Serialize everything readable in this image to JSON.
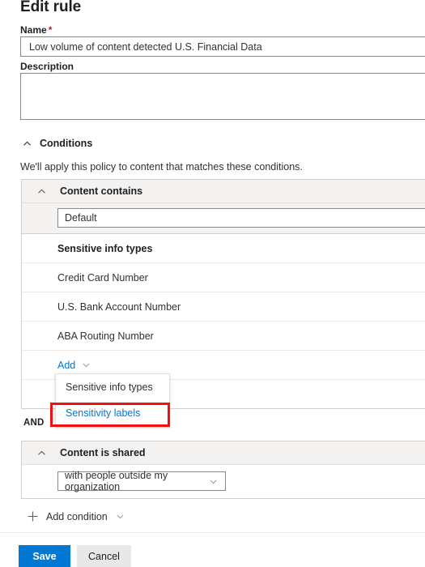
{
  "page": {
    "title": "Edit rule"
  },
  "name_field": {
    "label": "Name",
    "required_marker": "*",
    "value": "Low volume of content detected U.S. Financial Data",
    "placeholder": "Name"
  },
  "description_field": {
    "label": "Description",
    "value": "",
    "placeholder": ""
  },
  "conditions": {
    "header_label": "Conditions",
    "collapse_icon": "chevron-up-icon",
    "description": "We'll apply this policy to content that matches these conditions.",
    "and_label": "AND",
    "content_contains": {
      "header_label": "Content contains",
      "collapse_icon": "chevron-up-icon",
      "group_select_value": "Default",
      "list_header": "Sensitive info types",
      "items": [
        "Credit Card Number",
        "U.S. Bank Account Number",
        "ABA Routing Number"
      ],
      "add_label": "Add",
      "add_chevron_icon": "chevron-down-icon",
      "add_menu": {
        "options": [
          "Sensitive info types",
          "Sensitivity labels"
        ],
        "highlighted_option": "Sensitivity labels"
      }
    },
    "content_is_shared": {
      "header_label": "Content is shared",
      "collapse_icon": "chevron-up-icon",
      "select_value": "with people outside my organization",
      "select_chevron_icon": "chevron-down-icon"
    }
  },
  "add_condition": {
    "label": "Add condition",
    "plus_icon": "plus-icon",
    "chevron_icon": "chevron-down-icon"
  },
  "footer": {
    "save_label": "Save",
    "cancel_label": "Cancel"
  },
  "colors": {
    "accent": "#0078d4",
    "link": "#0078d4",
    "required": "#a4262c",
    "highlight_box": "#ee1111",
    "panel_header_bg": "#f3f2f1",
    "border": "#d2d0ce"
  }
}
